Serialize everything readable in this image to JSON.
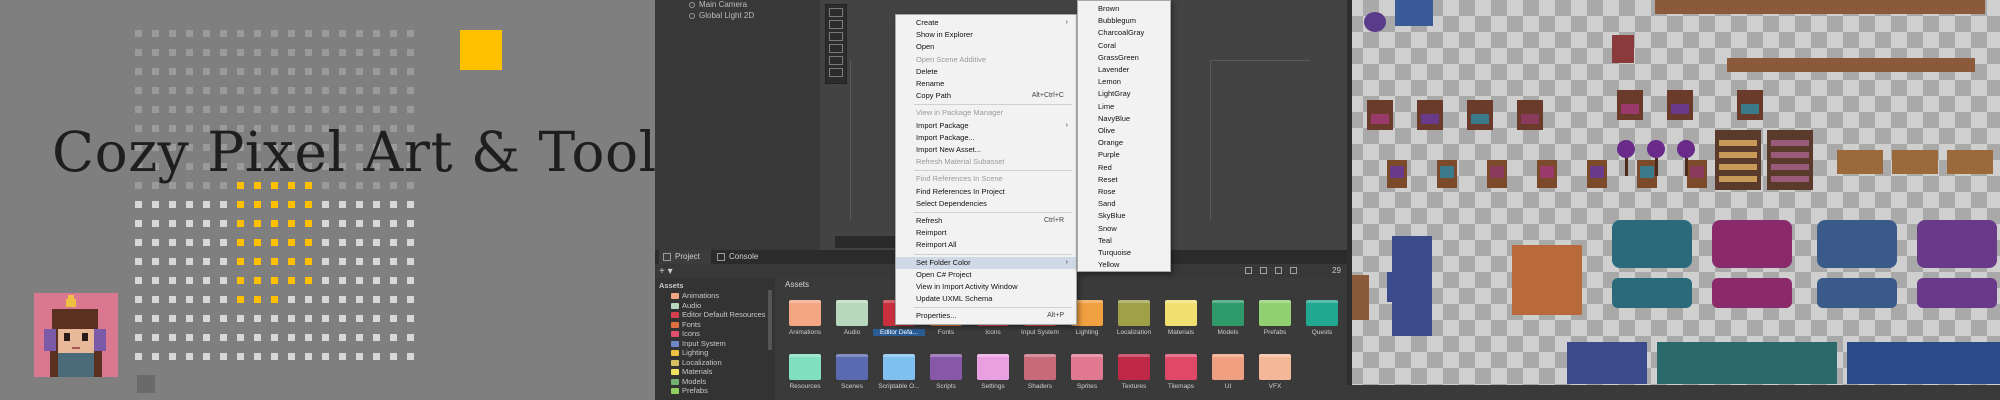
{
  "banner": {
    "title": "Cozy Pixel Art & Tools",
    "accent_color": "#ffc000",
    "avatar_icon": "girl-with-headphones-avatar"
  },
  "hierarchy": {
    "items": [
      "Main Camera",
      "Global Light 2D"
    ]
  },
  "bottom_panel": {
    "tabs": [
      {
        "label": "Project",
        "icon": "folder-icon"
      },
      {
        "label": "Console",
        "icon": "console-icon"
      }
    ],
    "add_label": "+ ▾",
    "hidden_count": "29",
    "breadcrumb": "Assets"
  },
  "project_tree": {
    "root": "Assets",
    "items": [
      {
        "label": "Animations",
        "color": "#f4a582"
      },
      {
        "label": "Audio",
        "color": "#b8d8be"
      },
      {
        "label": "Editor Default Resources",
        "color": "#d6404e"
      },
      {
        "label": "Fonts",
        "color": "#e07040"
      },
      {
        "label": "Icons",
        "color": "#e0506a"
      },
      {
        "label": "Input System",
        "color": "#7088c8"
      },
      {
        "label": "Lighting",
        "color": "#f0c040"
      },
      {
        "label": "Localization",
        "color": "#d8c060"
      },
      {
        "label": "Materials",
        "color": "#f0e060"
      },
      {
        "label": "Models",
        "color": "#70b070"
      },
      {
        "label": "Prefabs",
        "color": "#90d060"
      }
    ]
  },
  "assets_grid": {
    "row1": [
      {
        "label": "Animations",
        "color": "#f4a582"
      },
      {
        "label": "Audio",
        "color": "#b8d8be"
      },
      {
        "label": "Editor Defa...",
        "color": "#c8303e",
        "selected": true
      },
      {
        "label": "Fonts",
        "color": "#e07a3a"
      },
      {
        "label": "Icons",
        "color": "#d9485e"
      },
      {
        "label": "Input System",
        "color": "#e05050"
      },
      {
        "label": "Lighting",
        "color": "#f0a040"
      },
      {
        "label": "Localization",
        "color": "#a0a048"
      },
      {
        "label": "Materials",
        "color": "#f0e070"
      },
      {
        "label": "Models",
        "color": "#2e9a6a"
      },
      {
        "label": "Prefabs",
        "color": "#90d070"
      },
      {
        "label": "Quests",
        "color": "#20a890"
      }
    ],
    "row2": [
      {
        "label": "Resources",
        "color": "#80e0c0"
      },
      {
        "label": "Scenes",
        "color": "#5a6ab0"
      },
      {
        "label": "Scriptable O...",
        "color": "#80c0f0"
      },
      {
        "label": "Scripts",
        "color": "#8858a8"
      },
      {
        "label": "Settings",
        "color": "#e8a0e0"
      },
      {
        "label": "Shaders",
        "color": "#c86a7a"
      },
      {
        "label": "Sprites",
        "color": "#e07890"
      },
      {
        "label": "Textures",
        "color": "#c02848"
      },
      {
        "label": "Tilemaps",
        "color": "#e04868"
      },
      {
        "label": "UI",
        "color": "#f0a080"
      },
      {
        "label": "VFX",
        "color": "#f4b898"
      }
    ]
  },
  "context_menu": {
    "items": [
      {
        "label": "Create",
        "arrow": true
      },
      {
        "label": "Show in Explorer"
      },
      {
        "label": "Open"
      },
      {
        "label": "Open Scene Additive",
        "disabled": true
      },
      {
        "label": "Delete"
      },
      {
        "label": "Rename"
      },
      {
        "label": "Copy Path",
        "shortcut": "Alt+Ctrl+C"
      },
      {
        "sep": true
      },
      {
        "label": "View in Package Manager",
        "disabled": true
      },
      {
        "label": "Import Package",
        "arrow": true
      },
      {
        "label": "Import Package..."
      },
      {
        "label": "Import New Asset..."
      },
      {
        "label": "Refresh Material Subasset",
        "disabled": true
      },
      {
        "sep": true
      },
      {
        "label": "Find References In Scene",
        "disabled": true
      },
      {
        "label": "Find References In Project"
      },
      {
        "label": "Select Dependencies"
      },
      {
        "sep": true
      },
      {
        "label": "Refresh",
        "shortcut": "Ctrl+R"
      },
      {
        "label": "Reimport"
      },
      {
        "label": "Reimport All"
      },
      {
        "sep": true
      },
      {
        "label": "Set Folder Color",
        "arrow": true,
        "highlight": true
      },
      {
        "label": "Open C# Project"
      },
      {
        "label": "View in Import Activity Window"
      },
      {
        "label": "Update UXML Schema"
      },
      {
        "sep": true
      },
      {
        "label": "Properties...",
        "shortcut": "Alt+P"
      }
    ]
  },
  "folder_color_menu": {
    "items": [
      "Brown",
      "Bubblegum",
      "CharcoalGray",
      "Coral",
      "GrassGreen",
      "Lavender",
      "Lemon",
      "LightGray",
      "Lime",
      "NavyBlue",
      "Olive",
      "Orange",
      "Purple",
      "Red",
      "Reset",
      "Rose",
      "Sand",
      "SkyBlue",
      "Snow",
      "Teal",
      "Turquoise",
      "Yellow"
    ]
  }
}
